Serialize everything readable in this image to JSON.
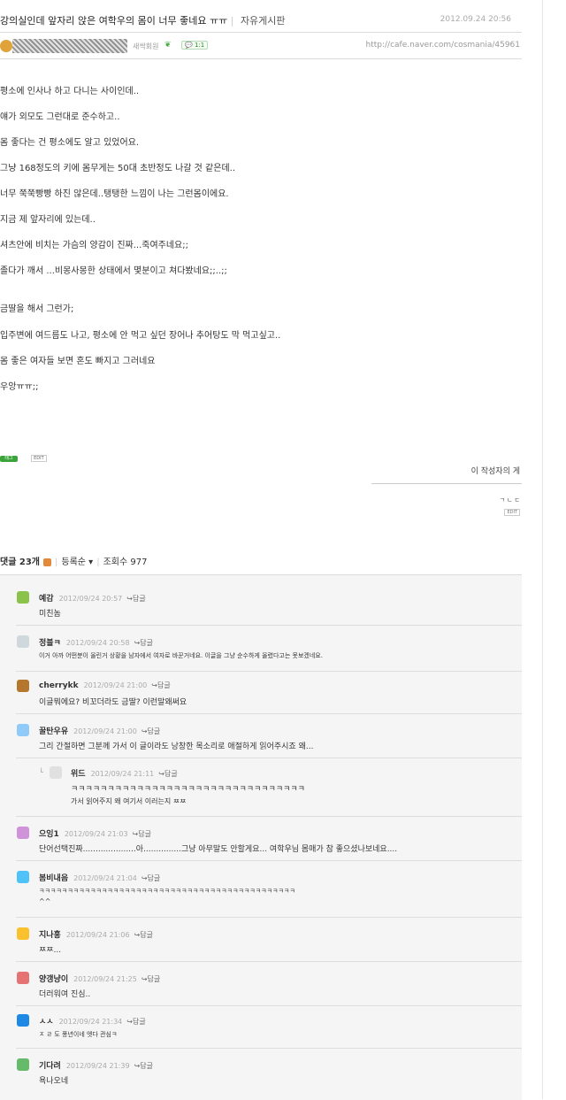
{
  "post": {
    "title": "강의실인데 앞자리 앉은 여학우의 몸이 너무 좋네요 ㅠㅠ",
    "board": "자유게시판",
    "date": "2012.09.24 20:56",
    "grade": "새싹회원",
    "badge": "1:1",
    "url": "http://cafe.naver.com/cosmania/45961",
    "lines": [
      "평소에 인사나 하고 다니는 사이인데..",
      "얘가 외모도 그런대로 준수하고..",
      "몸 좋다는 건 평소에도 알고 있었어요.",
      "그냥 168정도의 키에 몸무게는 50대 초반정도 나갈 것 같은데..",
      "너무 쭉쭉빵빵 하진 않은데..탱탱한 느낌이 나는 그런몸이에요.",
      "지금 제 앞자리에 있는데..",
      "셔츠안에 비치는 가슴의 양감이 진짜...죽여주네요;;",
      "졸다가 깨서 ...비몽사몽한 상태에서 몇분이고 쳐다봤네요;;..;;",
      "금딸을 해서 그런가;",
      "입주변에 여드름도 나고, 평소에 안 먹고 싶던 장어나 추어탕도 막 먹고싶고..",
      "몸 좋은 여자들 보면 혼도 빠지고 그러네요",
      "우앙ㅠㅠ;;"
    ],
    "tag_label": "태그",
    "edit_label": "EDIT",
    "writer_more": "이 작성자의 게",
    "mini_text": "ㄱㄴㄷ",
    "mini_edit": "EDIT"
  },
  "comments_bar": {
    "count_label": "댓글 23개",
    "sort_label": "등록순",
    "views_label": "조회수 977"
  },
  "comments": [
    {
      "nick": "예감",
      "date": "2012/09/24 20:57",
      "reply": "답글",
      "text": "미친놈",
      "color": "#8bc34a"
    },
    {
      "nick": "정블ㅋ",
      "date": "2012/09/24 20:58",
      "reply": "답글",
      "text": "이거 아까 어떤분이 올린거 상황을 남자에서 여자로 바꾼거네요. 이글을 그냥 순수하게 올렸다고는 못보겠네요.",
      "color": "#cfd8dc"
    },
    {
      "nick": "cherrykk",
      "date": "2012/09/24 21:00",
      "reply": "답글",
      "text": "이글뭐에요? 비꼬더라도 금딸? 이런말왜써요",
      "color": "#b5772e"
    },
    {
      "nick": "꿀탄우유",
      "date": "2012/09/24 21:00",
      "reply": "답글",
      "text": "그리 간절하면 그분께 가서 이 글이라도 낭창한 목소리로 애절하게 읽어주시죠 왜...",
      "color": "#90caf9"
    },
    {
      "nick": "위드",
      "date": "2012/09/24 21:11",
      "reply": "답글",
      "text": "ㅋㅋㅋㅋㅋㅋㅋㅋㅋㅋㅋㅋㅋㅋㅋㅋㅋㅋㅋㅋㅋㅋㅋㅋㅋㅋㅋㅋㅋㅋㅋㅋ",
      "text2": "가서 읽어주지 왜 여기서 이러는지 ㅉㅉ",
      "color": "#e0e0e0"
    },
    {
      "nick": "으잉1",
      "date": "2012/09/24 21:03",
      "reply": "답글",
      "text": "단어선택진짜.....................아...............그냥 아무말도 안할게요... 여학우님 몸매가 참 좋으셨나보네요....",
      "color": "#ce93d8"
    },
    {
      "nick": "봄비내음",
      "date": "2012/09/24 21:04",
      "reply": "답글",
      "text": "ㅋㅋㅋㅋㅋㅋㅋㅋㅋㅋㅋㅋㅋㅋㅋㅋㅋㅋㅋㅋㅋㅋㅋㅋㅋㅋㅋㅋㅋㅋㅋㅋㅋㅋㅋㅋㅋㅋㅋㅋㅋㅋㅋㅋㅋ",
      "text2": "^^",
      "color": "#4fc3f7"
    },
    {
      "nick": "지나홍",
      "date": "2012/09/24 21:06",
      "reply": "답글",
      "text": "ㅉㅉ...",
      "color": "#fbc02d"
    },
    {
      "nick": "양갱냥이",
      "date": "2012/09/24 21:25",
      "reply": "답글",
      "text": "더러워여 진심..",
      "color": "#e57373"
    },
    {
      "nick": "ㅅㅅ",
      "date": "2012/09/24 21:34",
      "reply": "답글",
      "text": "ㅈ ㄹ 도 풍년이네 엣다 관심ㅋ",
      "color": "#1e88e5"
    },
    {
      "nick": "기다려",
      "date": "2012/09/24 21:39",
      "reply": "답글",
      "text": "욕나오네",
      "color": "#66bb6a"
    }
  ]
}
